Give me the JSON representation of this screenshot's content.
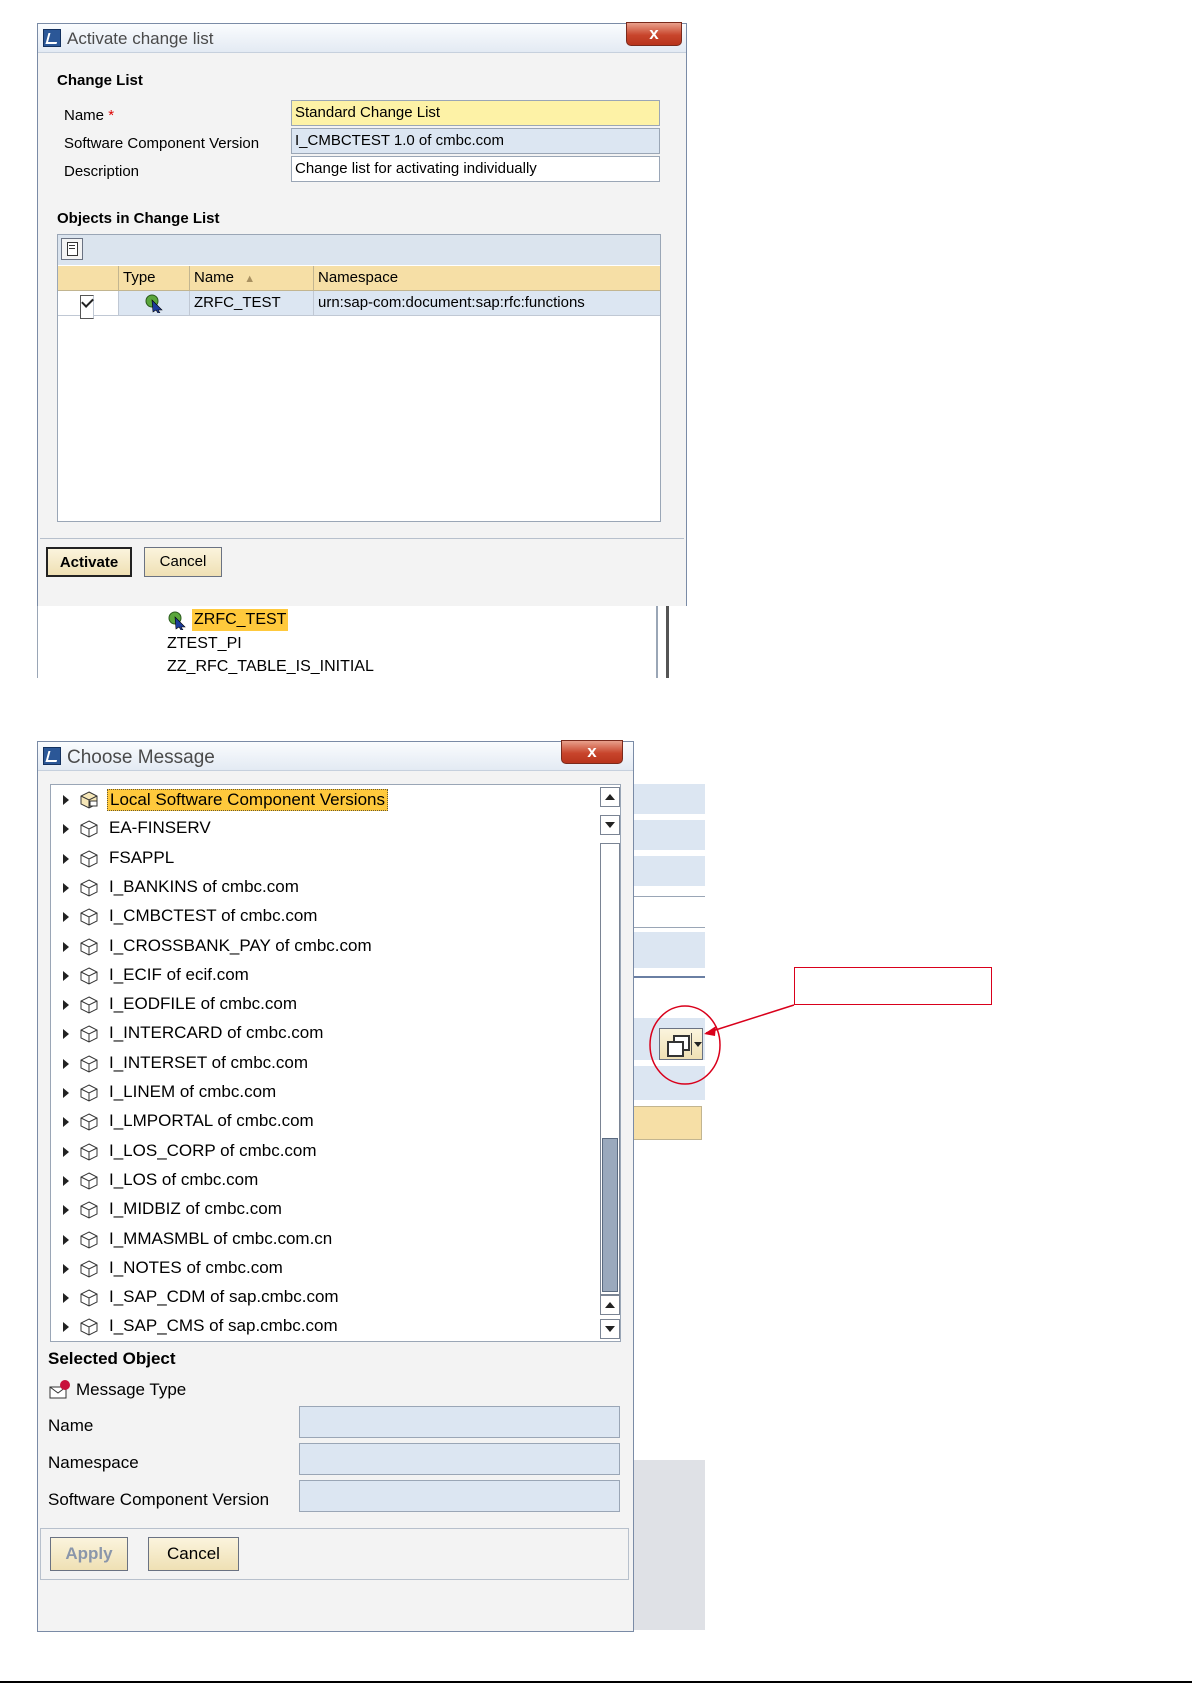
{
  "activate_dialog": {
    "title": "Activate change list",
    "close_label": "x",
    "change_list_heading": "Change List",
    "name_label": "Name",
    "required_mark": "*",
    "name_value": "Standard Change List",
    "swcv_label": "Software Component Version",
    "swcv_value": "I_CMBCTEST 1.0 of cmbc.com",
    "description_label": "Description",
    "description_value": "Change list for activating individually",
    "objects_heading": "Objects in Change List",
    "columns": {
      "type": "Type",
      "name": "Name",
      "namespace": "Namespace"
    },
    "rows": [
      {
        "checked": true,
        "type_icon": "rfc-icon",
        "name": "ZRFC_TEST",
        "namespace": "urn:sap-com:document:sap:rfc:functions"
      }
    ],
    "activate_label": "Activate",
    "cancel_label": "Cancel"
  },
  "background_list": {
    "items": [
      "ZRFC_TEST",
      "ZTEST_PI",
      "ZZ_RFC_TABLE_IS_INITIAL"
    ]
  },
  "choose_dialog": {
    "title": "Choose Message",
    "close_label": "x",
    "tree_items": [
      "Local Software Component Versions",
      "EA-FINSERV",
      "FSAPPL",
      "I_BANKINS of cmbc.com",
      "I_CMBCTEST of cmbc.com",
      "I_CROSSBANK_PAY of cmbc.com",
      "I_ECIF of ecif.com",
      "I_EODFILE of cmbc.com",
      "I_INTERCARD of cmbc.com",
      "I_INTERSET of cmbc.com",
      "I_LINEM of cmbc.com",
      "I_LMPORTAL of cmbc.com",
      "I_LOS_CORP of cmbc.com",
      "I_LOS of cmbc.com",
      "I_MIDBIZ of cmbc.com",
      "I_MMASMBL of cmbc.com.cn",
      "I_NOTES of cmbc.com",
      "I_SAP_CDM of sap.cmbc.com",
      "I_SAP_CMS of sap.cmbc.com"
    ],
    "selected_heading": "Selected Object",
    "message_type_label": "Message Type",
    "name_label": "Name",
    "namespace_label": "Namespace",
    "swcv_label": "Software Component Version",
    "name_value": "",
    "namespace_value": "",
    "swcv_value": "",
    "apply_label": "Apply",
    "cancel_label": "Cancel"
  },
  "colors": {
    "required_field": "#fdf2a6",
    "readonly_field": "#dce6f2",
    "selection": "#ffc93c",
    "annotation": "#d9001b"
  }
}
